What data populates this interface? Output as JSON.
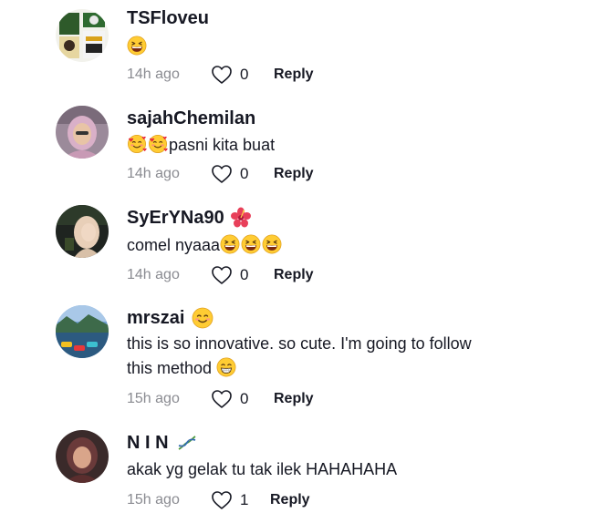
{
  "comments": [
    {
      "username": "TSFloveu",
      "text_lines": [
        ""
      ],
      "timestamp": "14h ago",
      "likes": "0",
      "reply_label": "Reply"
    },
    {
      "username": "sajahChemilan",
      "text_lines": [
        "pasni kita buat"
      ],
      "timestamp": "14h ago",
      "likes": "0",
      "reply_label": "Reply"
    },
    {
      "username": "SyErYNa90",
      "text_lines": [
        "comel nyaaa"
      ],
      "timestamp": "14h ago",
      "likes": "0",
      "reply_label": "Reply"
    },
    {
      "username": "mrszai",
      "text_lines": [
        "this is so innovative. so cute. I'm going to follow",
        "this method"
      ],
      "timestamp": "15h ago",
      "likes": "0",
      "reply_label": "Reply"
    },
    {
      "username": "N I N",
      "text_lines": [
        "akak yg gelak tu tak ilek HAHAHAHA"
      ],
      "timestamp": "15h ago",
      "likes": "1",
      "reply_label": "Reply"
    }
  ],
  "icons": {
    "like": "heart-outline-icon",
    "laugh": "grinning-squinting-face-emoji",
    "love": "smiling-face-with-hearts-emoji",
    "blush": "smiling-face-emoji",
    "grin": "beaming-face-emoji",
    "hibiscus": "hibiscus-emoji",
    "dna": "dna-emoji"
  },
  "colors": {
    "text": "#161823",
    "meta": "#8a8b91",
    "background": "#ffffff"
  }
}
